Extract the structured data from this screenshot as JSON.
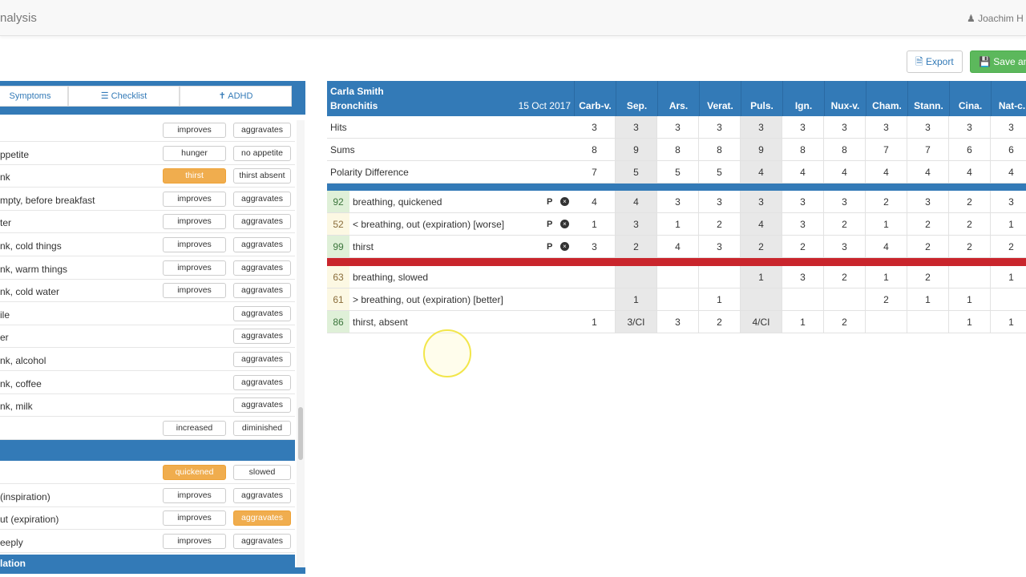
{
  "header": {
    "title": "nalysis",
    "user": "Joachim H",
    "user_icon": "user-icon"
  },
  "toolbar": {
    "export": "Export",
    "save": "Save an"
  },
  "tabs": [
    {
      "label": "Symptoms"
    },
    {
      "label": "Checklist",
      "icon": "list-icon"
    },
    {
      "label": "ADHD",
      "icon": "child-icon"
    }
  ],
  "symptoms": [
    {
      "label": "",
      "options": [
        "improves",
        "aggravates"
      ],
      "selected": null
    },
    {
      "label": "ppetite",
      "options": [
        "hunger",
        "no appetite"
      ],
      "selected": null
    },
    {
      "label": "nk",
      "options": [
        "thirst",
        "thirst absent"
      ],
      "selected": 0
    },
    {
      "label": "mpty, before breakfast",
      "options": [
        "improves",
        "aggravates"
      ],
      "selected": null
    },
    {
      "label": "ter",
      "options": [
        "improves",
        "aggravates"
      ],
      "selected": null
    },
    {
      "label": "nk, cold things",
      "options": [
        "improves",
        "aggravates"
      ],
      "selected": null
    },
    {
      "label": "nk, warm things",
      "options": [
        "improves",
        "aggravates"
      ],
      "selected": null
    },
    {
      "label": "nk, cold water",
      "options": [
        "improves",
        "aggravates"
      ],
      "selected": null
    },
    {
      "label": "ile",
      "options": [
        null,
        "aggravates"
      ],
      "selected": null
    },
    {
      "label": "er",
      "options": [
        null,
        "aggravates"
      ],
      "selected": null
    },
    {
      "label": "nk, alcohol",
      "options": [
        null,
        "aggravates"
      ],
      "selected": null
    },
    {
      "label": "nk, coffee",
      "options": [
        null,
        "aggravates"
      ],
      "selected": null
    },
    {
      "label": "nk, milk",
      "options": [
        null,
        "aggravates"
      ],
      "selected": null
    },
    {
      "label": "",
      "options": [
        "increased",
        "diminished"
      ],
      "selected": null
    }
  ],
  "symptoms2": [
    {
      "label": "",
      "options": [
        "quickened",
        "slowed"
      ],
      "selected": 0
    },
    {
      "label": " (inspiration)",
      "options": [
        "improves",
        "aggravates"
      ],
      "selected": null
    },
    {
      "label": "ut (expiration)",
      "options": [
        "improves",
        "aggravates"
      ],
      "selected": 1
    },
    {
      "label": "eeply",
      "options": [
        "improves",
        "aggravates"
      ],
      "selected": null
    }
  ],
  "section_footer": "lation",
  "analysis": {
    "patient": "Carla Smith",
    "case": "Bronchitis",
    "date": "15 Oct 2017",
    "remedies": [
      "Carb-v.",
      "Sep.",
      "Ars.",
      "Verat.",
      "Puls.",
      "Ign.",
      "Nux-v.",
      "Cham.",
      "Stann.",
      "Cina.",
      "Nat-c."
    ],
    "shaded": [
      1,
      4
    ],
    "summary": [
      {
        "label": "Hits",
        "values": [
          "3",
          "3",
          "3",
          "3",
          "3",
          "3",
          "3",
          "3",
          "3",
          "3",
          "3"
        ]
      },
      {
        "label": "Sums",
        "values": [
          "8",
          "9",
          "8",
          "8",
          "9",
          "8",
          "8",
          "7",
          "7",
          "6",
          "6"
        ]
      },
      {
        "label": "Polarity Difference",
        "values": [
          "7",
          "5",
          "5",
          "5",
          "4",
          "4",
          "4",
          "4",
          "4",
          "4",
          "4"
        ]
      }
    ],
    "selected_rubrics": [
      {
        "score": "92",
        "tone": "g",
        "label": "breathing, quickened",
        "values": [
          "4",
          "4",
          "3",
          "3",
          "3",
          "3",
          "3",
          "2",
          "3",
          "2",
          "3"
        ]
      },
      {
        "score": "52",
        "tone": "y",
        "label": "< breathing, out (expiration) [worse]",
        "values": [
          "1",
          "3",
          "1",
          "2",
          "4",
          "3",
          "2",
          "1",
          "2",
          "2",
          "1"
        ]
      },
      {
        "score": "99",
        "tone": "g",
        "label": "thirst",
        "values": [
          "3",
          "2",
          "4",
          "3",
          "2",
          "2",
          "3",
          "4",
          "2",
          "2",
          "2"
        ]
      }
    ],
    "counter_rubrics": [
      {
        "score": "63",
        "tone": "y",
        "label": "breathing, slowed",
        "values": [
          "",
          "",
          "",
          "",
          "1",
          "3",
          "2",
          "1",
          "2",
          "",
          "1"
        ]
      },
      {
        "score": "61",
        "tone": "y",
        "label": "> breathing, out (expiration) [better]",
        "values": [
          "",
          "1",
          "",
          "1",
          "",
          "",
          "",
          "2",
          "1",
          "1",
          ""
        ]
      },
      {
        "score": "86",
        "tone": "g",
        "label": "thirst, absent",
        "values": [
          "1",
          "3/CI",
          "3",
          "2",
          "4/CI",
          "1",
          "2",
          "",
          "",
          "1",
          "1"
        ]
      }
    ],
    "polarity_marker": "P"
  },
  "colors": {
    "primary": "#337ab7",
    "selected": "#f0ad4e",
    "counter_bar": "#c9252c",
    "save": "#5cb85c"
  }
}
